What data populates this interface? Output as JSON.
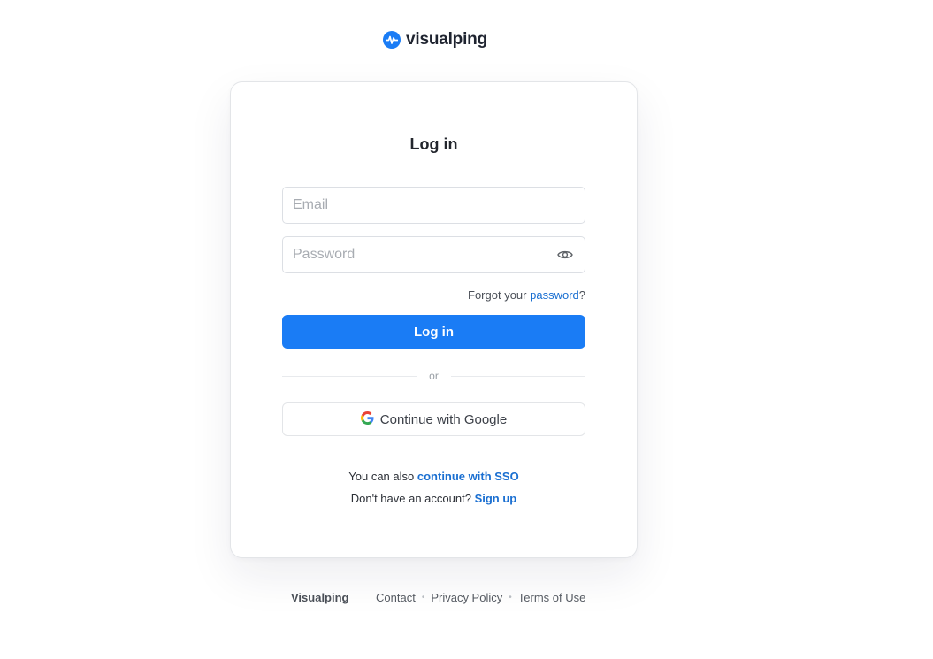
{
  "brand": {
    "name": "visualping",
    "accent_color": "#1a7cf5",
    "icon": "pulse-logo-icon"
  },
  "login_card": {
    "title": "Log in",
    "email_placeholder": "Email",
    "password_placeholder": "Password",
    "password_visibility_icon": "eye-icon",
    "forgot_prefix": "Forgot your",
    "forgot_link": "password",
    "forgot_suffix": "?",
    "login_button": "Log in",
    "divider_text": "or",
    "google_button": "Continue with Google",
    "google_icon": "google-g-icon",
    "sso_prefix": "You can also",
    "sso_link": "continue with SSO",
    "signup_prefix": "Don't have an account?",
    "signup_link": "Sign up"
  },
  "footer": {
    "brand": "Visualping",
    "links": [
      "Contact",
      "Privacy Policy",
      "Terms of Use"
    ]
  }
}
